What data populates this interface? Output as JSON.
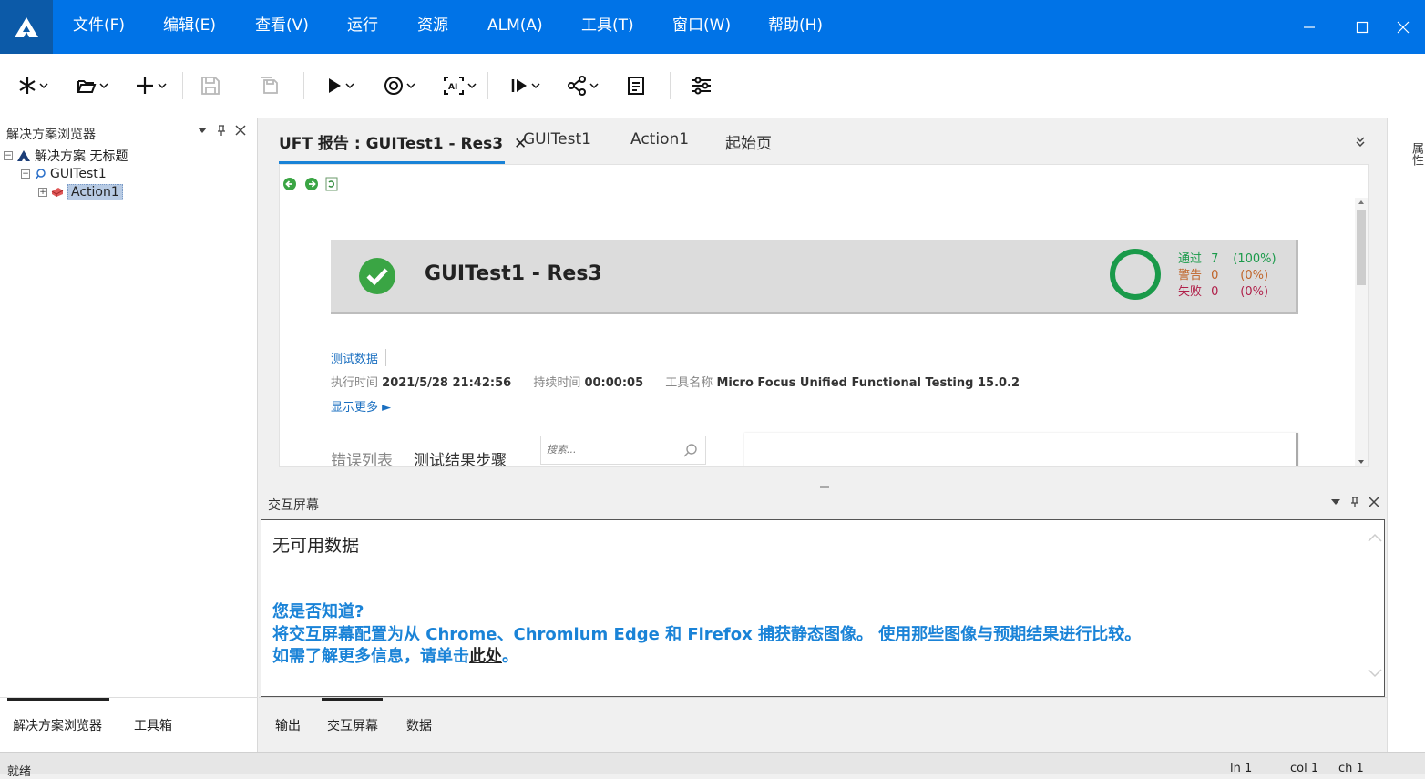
{
  "menu": {
    "items": [
      "文件(F)",
      "编辑(E)",
      "查看(V)",
      "运行",
      "资源",
      "ALM(A)",
      "工具(T)",
      "窗口(W)",
      "帮助(H)"
    ]
  },
  "left_panel": {
    "title": "解决方案浏览器",
    "tree": {
      "solution": "解决方案 无标题",
      "test": "GUITest1",
      "action": "Action1"
    },
    "tabs": [
      "解决方案浏览器",
      "工具箱"
    ]
  },
  "doc_tabs": {
    "report": "UFT 报告 : GUITest1 - Res3",
    "test": "GUITest1",
    "action": "Action1",
    "start": "起始页"
  },
  "report": {
    "title": "GUITest1 - Res3",
    "stats": {
      "pass_label": "通过",
      "pass_count": "7",
      "pass_pct": "(100%)",
      "warn_label": "警告",
      "warn_count": "0",
      "warn_pct": "(0%)",
      "fail_label": "失败",
      "fail_count": "0",
      "fail_pct": "(0%)"
    },
    "test_data_link": "测试数据",
    "exec_time_label": "执行时间",
    "exec_time": "2021/5/28 21:42:56",
    "duration_label": "持续时间",
    "duration": "00:00:05",
    "tool_label": "工具名称",
    "tool": "Micro Focus Unified Functional Testing 15.0.2",
    "show_more": "显示更多 ►",
    "tab_errors": "错误列表",
    "tab_steps": "测试结果步骤",
    "search_placeholder": "搜索..."
  },
  "interactive": {
    "title": "交互屏幕",
    "no_data": "无可用数据",
    "tip_title": "您是否知道?",
    "tip_line1": "将交互屏幕配置为从 Chrome、Chromium Edge 和 Firefox 捕获静态图像。 使用那些图像与预期结果进行比较。",
    "tip_line2_prefix": "如需了解更多信息，请单击",
    "tip_link": "此处",
    "tip_line2_suffix": "。",
    "tabs": [
      "输出",
      "交互屏幕",
      "数据"
    ]
  },
  "right_strip": {
    "label": "属性"
  },
  "status": {
    "left": "就绪",
    "ln": "ln 1",
    "col": "col 1",
    "ch": "ch 1"
  },
  "colors": {
    "menubar": "#0073e7",
    "accent": "#1a83d7",
    "pass": "#1a9a4a",
    "warn": "#c0652a",
    "fail": "#b0204a"
  }
}
